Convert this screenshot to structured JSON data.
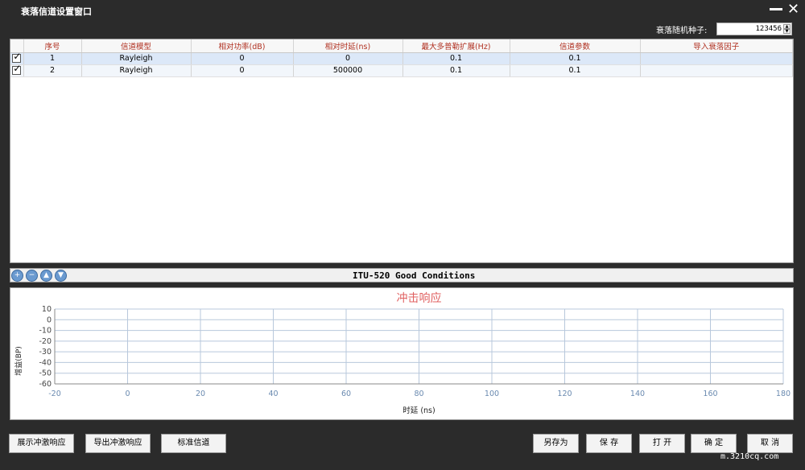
{
  "window": {
    "title": "衰落信道设置窗口"
  },
  "seed": {
    "label": "衰落随机种子:",
    "value": "123456"
  },
  "table": {
    "columns": [
      "序号",
      "信道模型",
      "相对功率(dB)",
      "相对时延(ns)",
      "最大多普勒扩展(Hz)",
      "信道参数",
      "导入衰落因子"
    ],
    "rows": [
      {
        "checked": true,
        "cells": [
          "1",
          "Rayleigh",
          "0",
          "0",
          "0.1",
          "0.1",
          ""
        ]
      },
      {
        "checked": true,
        "cells": [
          "2",
          "Rayleigh",
          "0",
          "500000",
          "0.1",
          "0.1",
          ""
        ]
      }
    ]
  },
  "toolbar": {
    "condition": "ITU-520 Good Conditions",
    "icons": [
      "add-icon",
      "remove-icon",
      "move-up-icon",
      "move-down-icon"
    ]
  },
  "chart_data": {
    "type": "line",
    "title": "冲击响应",
    "xlabel": "时延 (ns)",
    "ylabel": "增益(BP)",
    "xlim": [
      -20,
      180
    ],
    "ylim": [
      -60,
      10
    ],
    "xticks": [
      -20,
      0,
      20,
      40,
      60,
      80,
      100,
      120,
      140,
      160,
      180
    ],
    "yticks": [
      10,
      0,
      -10,
      -20,
      -30,
      -40,
      -50,
      -60
    ],
    "grid": true,
    "series": [],
    "colors": {
      "title": "#e06060",
      "grid": "#b8c8dc",
      "axis": "#888888"
    }
  },
  "buttons": {
    "show_impulse": "展示冲激响应",
    "export_impulse": "导出冲激响应",
    "standard_channel": "标准信道",
    "save_as": "另存为",
    "save": "保 存",
    "open": "打 开",
    "ok": "确 定",
    "cancel": "取 消"
  },
  "watermark": "m.3210cq.com"
}
